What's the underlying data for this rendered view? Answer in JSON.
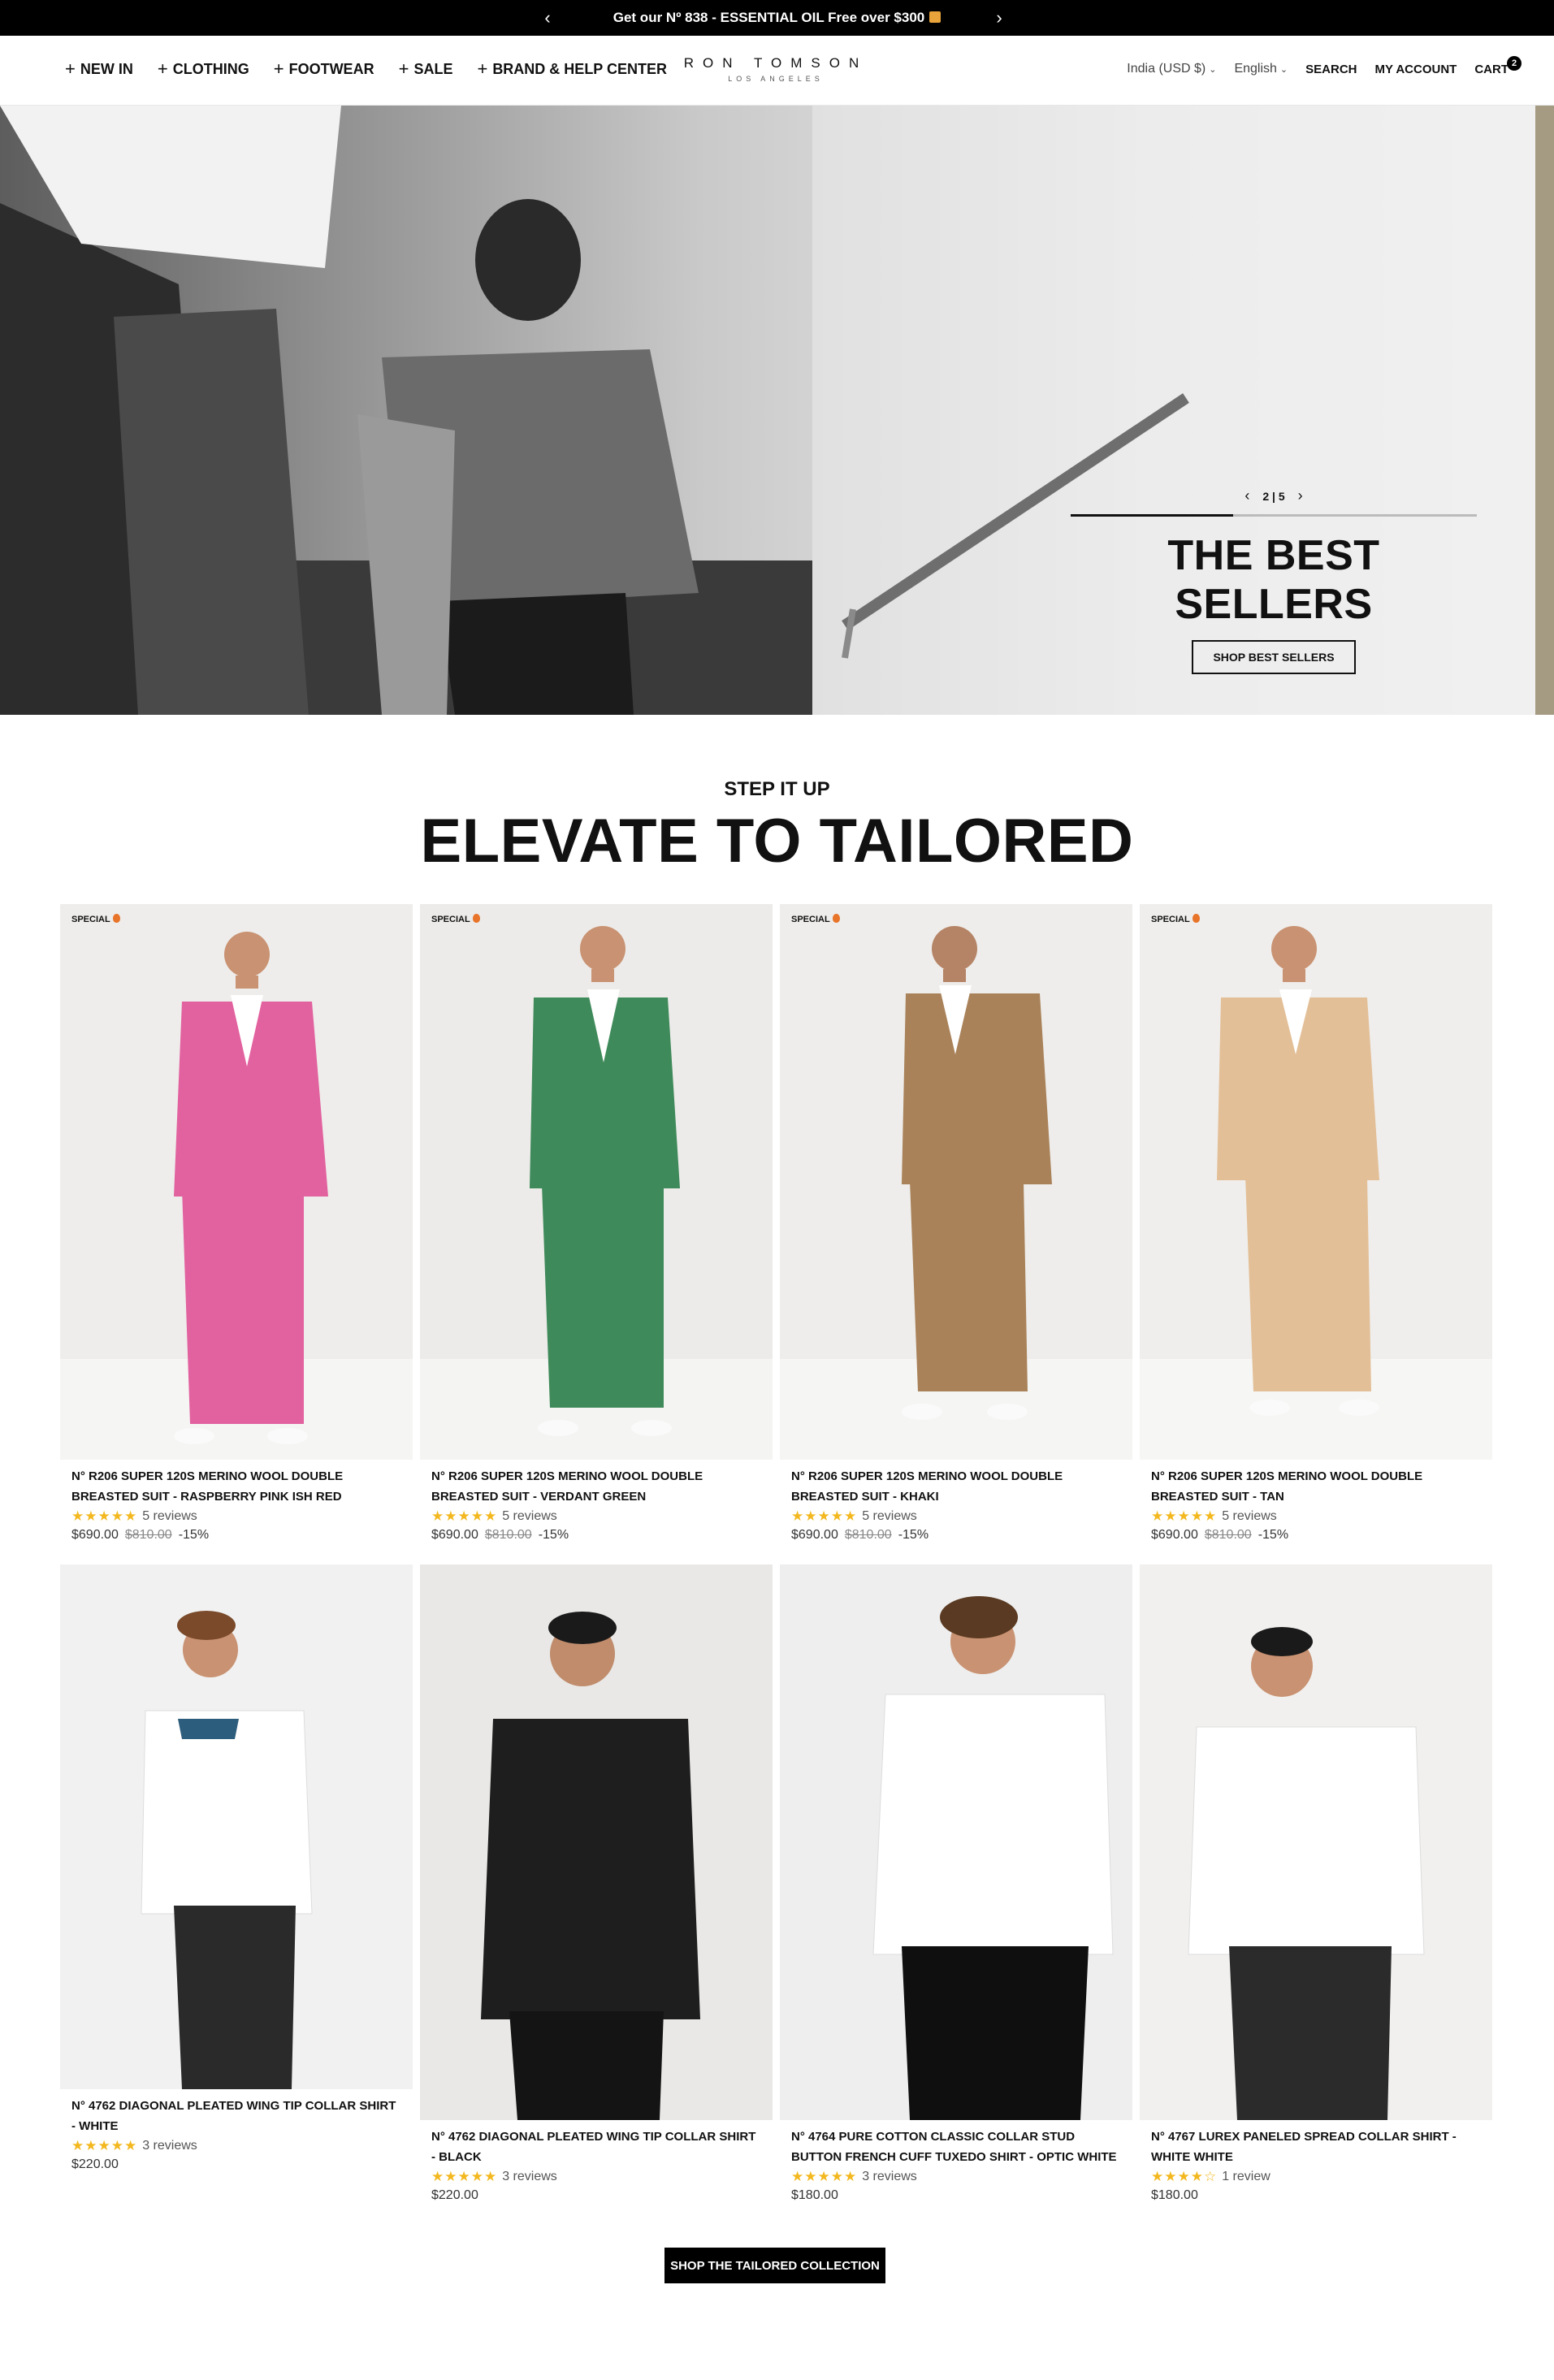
{
  "announcement": {
    "prev_icon": "chevron-left-icon",
    "text": "Get our Nº 838 - ESSENTIAL OIL Free over $300",
    "gift_icon": "gift-icon",
    "next_icon": "chevron-right-icon"
  },
  "header": {
    "nav": [
      {
        "label": "NEW IN"
      },
      {
        "label": "CLOTHING"
      },
      {
        "label": "FOOTWEAR"
      },
      {
        "label": "SALE"
      },
      {
        "label": "BRAND & HELP CENTER"
      }
    ],
    "logo": {
      "main": "RON TOMSON",
      "sub": "LOS ANGELES"
    },
    "currency": "India (USD $)",
    "language": "English",
    "search": "SEARCH",
    "account": "MY ACCOUNT",
    "cart": "CART",
    "cart_count": "2"
  },
  "hero": {
    "page": "2 | 5",
    "progress_fraction": 0.4,
    "title": "THE BEST SELLERS",
    "button": "SHOP BEST SELLERS"
  },
  "section": {
    "subtitle": "STEP IT UP",
    "title": "ELEVATE TO TAILORED"
  },
  "products": [
    {
      "badge": "SPECIAL",
      "name": "N° R206 SUPER 120S MERINO WOOL DOUBLE BREASTED SUIT - RASPBERRY PINK ISH RED",
      "stars": "★★★★★",
      "reviews": "5 reviews",
      "price": "$690.00",
      "old_price": "$810.00",
      "discount": "-15%",
      "color": "#e2619f"
    },
    {
      "badge": "SPECIAL",
      "name": "N° R206 SUPER 120S MERINO WOOL DOUBLE BREASTED SUIT - VERDANT GREEN",
      "stars": "★★★★★",
      "reviews": "5 reviews",
      "price": "$690.00",
      "old_price": "$810.00",
      "discount": "-15%",
      "color": "#3f8a5a"
    },
    {
      "badge": "SPECIAL",
      "name": "N° R206 SUPER 120S MERINO WOOL DOUBLE BREASTED SUIT - KHAKI",
      "stars": "★★★★★",
      "reviews": "5 reviews",
      "price": "$690.00",
      "old_price": "$810.00",
      "discount": "-15%",
      "color": "#a98259"
    },
    {
      "badge": "SPECIAL",
      "name": "N° R206 SUPER 120S MERINO WOOL DOUBLE BREASTED SUIT - TAN",
      "stars": "★★★★★",
      "reviews": "5 reviews",
      "price": "$690.00",
      "old_price": "$810.00",
      "discount": "-15%",
      "color": "#e3bf97"
    },
    {
      "badge": "",
      "name": "N° 4762 DIAGONAL PLEATED WING TIP COLLAR SHIRT - WHITE",
      "stars": "★★★★★",
      "reviews": "3 reviews",
      "price": "$220.00",
      "old_price": "",
      "discount": "",
      "color": "#ffffff"
    },
    {
      "badge": "",
      "name": "N° 4762 DIAGONAL PLEATED WING TIP COLLAR SHIRT - BLACK",
      "stars": "★★★★★",
      "reviews": "3 reviews",
      "price": "$220.00",
      "old_price": "",
      "discount": "",
      "color": "#1e1e1e"
    },
    {
      "badge": "",
      "name": "N° 4764 PURE COTTON CLASSIC COLLAR STUD BUTTON FRENCH CUFF TUXEDO SHIRT - OPTIC WHITE",
      "stars": "★★★★★",
      "reviews": "3 reviews",
      "price": "$180.00",
      "old_price": "",
      "discount": "",
      "color": "#ffffff"
    },
    {
      "badge": "",
      "name": "N° 4767 LUREX PANELED SPREAD COLLAR SHIRT - WHITE WHITE",
      "stars": "★★★★☆",
      "reviews": "1 review",
      "price": "$180.00",
      "old_price": "",
      "discount": "",
      "color": "#ffffff"
    }
  ],
  "cta": {
    "label": "SHOP THE TAILORED COLLECTION"
  },
  "colors": {
    "black": "#000000",
    "star": "#f3b81f",
    "flame": "#e8742a"
  }
}
